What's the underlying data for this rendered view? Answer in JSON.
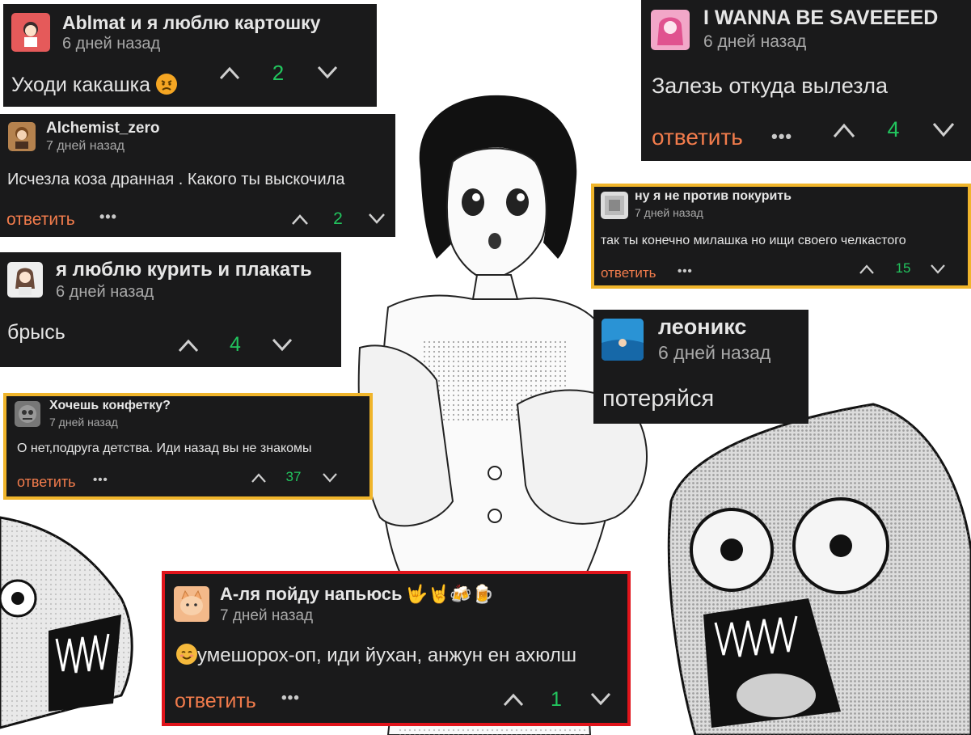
{
  "comments": [
    {
      "id": "c1",
      "user": "Ablmat и я люблю картошку",
      "time": "6 дней назад",
      "text": "Уходи какашка",
      "emoji": "angry-face-emoji",
      "votes": "2",
      "reply": "",
      "avatar_color": "#e55a5a"
    },
    {
      "id": "c2",
      "user": "Alchemist_zero",
      "time": "7 дней назад",
      "text": "Исчезла коза дранная . Какого ты выскочила",
      "votes": "2",
      "reply": "ответить",
      "avatar_color": "#b5824e"
    },
    {
      "id": "c3",
      "user": "я люблю курить и плакать",
      "time": "6 дней назад",
      "text": "брысь",
      "votes": "4",
      "reply": "",
      "avatar_color": "#eeeeee"
    },
    {
      "id": "c4",
      "user": "Хочешь конфетку?",
      "time": "7 дней назад",
      "text": "О нет,подруга детства. Иди назад вы не знакомы",
      "votes": "37",
      "reply": "ответить",
      "avatar_color": "#777777"
    },
    {
      "id": "c5",
      "user": "I WANNA BE SAVEEEED",
      "time": "6 дней назад",
      "text": "Залезь откуда вылезла",
      "votes": "4",
      "reply": "ответить",
      "avatar_color": "#f2a7c8"
    },
    {
      "id": "c6",
      "user": "ну я не против покурить",
      "time": "7 дней назад",
      "text": "так ты конечно милашка но ищи своего челкастого",
      "votes": "15",
      "reply": "ответить",
      "avatar_color": "#dddddd"
    },
    {
      "id": "c7",
      "user": "леоникс",
      "time": "6 дней назад",
      "text": "потеряйся",
      "votes": "",
      "reply": "",
      "avatar_color": "#1b7fc2"
    },
    {
      "id": "c8",
      "user": "А-ля пойду напьюсь",
      "user_emoji": "🤟🤘🍻🍺",
      "time": "7 дней назад",
      "text": "умешорох-оп, иди йухан, анжун ен ахюлш",
      "emoji": "smiling-face-emoji",
      "votes": "1",
      "reply": "ответить",
      "avatar_color": "#f3b98a"
    }
  ],
  "colors": {
    "card_bg": "#1a1a1b",
    "reply": "#f27c4c",
    "votes": "#22c55e",
    "gold_border": "#f0b52b",
    "red_border": "#e0141b"
  }
}
